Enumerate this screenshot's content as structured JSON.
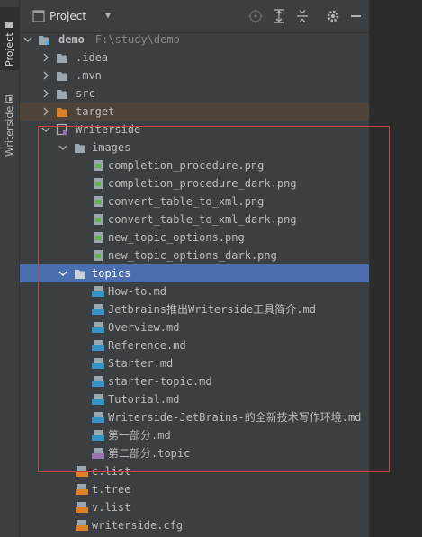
{
  "tool_strip": {
    "project_tab": "Project",
    "writerside_tab": "Writerside"
  },
  "header": {
    "title": "Project"
  },
  "tree": {
    "root": {
      "name": "demo",
      "path": "F:\\study\\demo"
    },
    "idea": ".idea",
    "mvn": ".mvn",
    "src": "src",
    "target": "target",
    "writerside": "Writerside",
    "images": "images",
    "image_files": [
      "completion_procedure.png",
      "completion_procedure_dark.png",
      "convert_table_to_xml.png",
      "convert_table_to_xml_dark.png",
      "new_topic_options.png",
      "new_topic_options_dark.png"
    ],
    "topics": "topics",
    "topic_files": [
      "How-to.md",
      "Jetbrains推出Writerside工具简介.md",
      "Overview.md",
      "Reference.md",
      "Starter.md",
      "starter-topic.md",
      "Tutorial.md",
      "Writerside-JetBrains-的全新技术写作环境.md",
      "第一部分.md",
      "第二部分.topic"
    ],
    "config_files": [
      "c.list",
      "t.tree",
      "v.list",
      "writerside.cfg"
    ]
  },
  "colors": {
    "selection": "#4b6eaf",
    "excluded_bg": "#4d4339",
    "highlight_box": "#c94345"
  }
}
